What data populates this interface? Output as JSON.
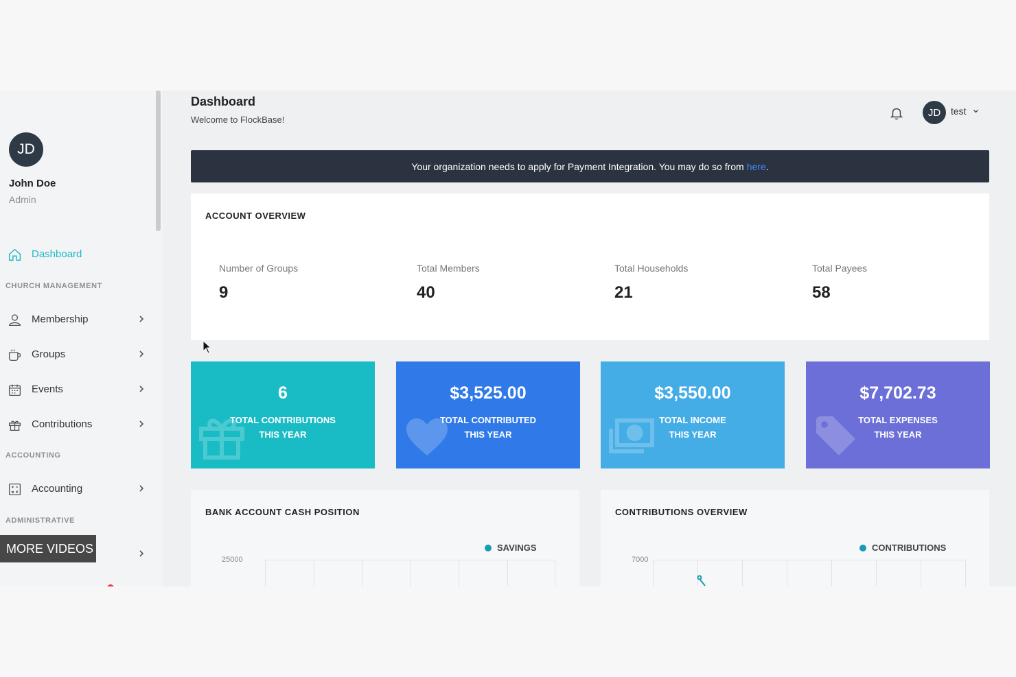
{
  "user": {
    "initials": "JD",
    "name": "John Doe",
    "role": "Admin"
  },
  "sidebar": {
    "dashboard": "Dashboard",
    "sections": {
      "church": "CHURCH MANAGEMENT",
      "accounting": "ACCOUNTING",
      "admin": "ADMINISTRATIVE"
    },
    "items": [
      {
        "label": "Membership",
        "icon": "person-icon"
      },
      {
        "label": "Groups",
        "icon": "cup-icon"
      },
      {
        "label": "Events",
        "icon": "calendar-icon"
      },
      {
        "label": "Contributions",
        "icon": "gift-icon"
      },
      {
        "label": "Accounting",
        "icon": "calculator-icon"
      }
    ],
    "overlay": "MORE VIDEOS"
  },
  "header": {
    "title": "Dashboard",
    "subtitle": "Welcome to FlockBase!",
    "user_initials": "JD",
    "username": "test"
  },
  "notice": {
    "text": "Your organization needs to apply for Payment Integration. You may do so from",
    "link": "here",
    "suffix": "."
  },
  "overview": {
    "title": "ACCOUNT OVERVIEW",
    "stats": [
      {
        "label": "Number of Groups",
        "value": "9"
      },
      {
        "label": "Total Members",
        "value": "40"
      },
      {
        "label": "Total Households",
        "value": "21"
      },
      {
        "label": "Total Payees",
        "value": "58"
      }
    ]
  },
  "tiles": [
    {
      "value": "6",
      "line1": "TOTAL CONTRIBUTIONS",
      "line2": "THIS YEAR",
      "color": "#19bcc4",
      "icon": "gift-icon"
    },
    {
      "value": "$3,525.00",
      "line1": "TOTAL CONTRIBUTED",
      "line2": "THIS YEAR",
      "color": "#2f7ae8",
      "icon": "heart-icon"
    },
    {
      "value": "$3,550.00",
      "line1": "TOTAL INCOME",
      "line2": "THIS YEAR",
      "color": "#45ade6",
      "icon": "money-icon"
    },
    {
      "value": "$7,702.73",
      "line1": "TOTAL EXPENSES",
      "line2": "THIS YEAR",
      "color": "#6c6fd8",
      "icon": "tag-icon"
    }
  ],
  "charts": {
    "bank": {
      "title": "BANK ACCOUNT CASH POSITION",
      "legend": "SAVINGS",
      "ytick": "25000"
    },
    "contrib": {
      "title": "CONTRIBUTIONS OVERVIEW",
      "legend": "CONTRIBUTIONS",
      "ytick": "7000"
    }
  }
}
